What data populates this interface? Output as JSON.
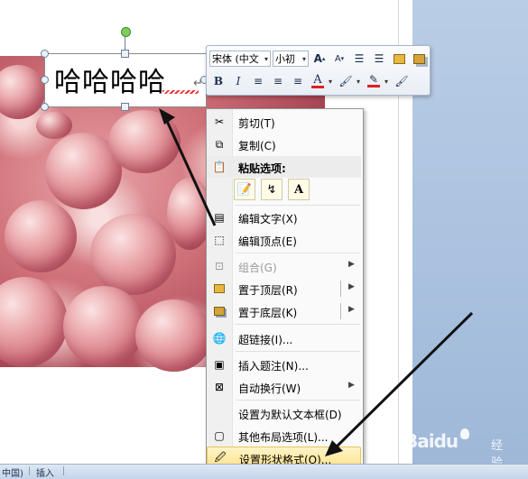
{
  "textbox": {
    "text": "哈哈哈哈"
  },
  "mini_toolbar": {
    "font_name": "宋体 (中文",
    "font_size": "小初",
    "row1_buttons": [
      "grow-font-icon",
      "shrink-font-icon",
      "decrease-indent-icon",
      "increase-indent-icon",
      "bring-forward-icon",
      "send-backward-icon"
    ],
    "row2_buttons": [
      "bold-icon",
      "italic-icon",
      "align-left-icon",
      "center-icon",
      "align-right-icon",
      "font-color-icon",
      "highlight-icon",
      "line-color-icon",
      "format-painter-icon"
    ],
    "bold_glyph": "B",
    "italic_glyph": "I",
    "font_color_glyph": "A"
  },
  "context_menu": {
    "cut": "剪切(T)",
    "copy": "复制(C)",
    "paste_options_title": "粘贴选项:",
    "paste_text_glyph": "A",
    "edit_text": "编辑文字(X)",
    "edit_points": "编辑顶点(E)",
    "group": "组合(G)",
    "bring_to_front": "置于顶层(R)",
    "send_to_back": "置于底层(K)",
    "hyperlink": "超链接(I)...",
    "insert_caption": "插入题注(N)...",
    "wrap_text": "自动换行(W)",
    "set_default_textbox": "设置为默认文本框(D)",
    "more_layout_options": "其他布局选项(L)...",
    "format_shape": "设置形状格式(O)..."
  },
  "status_bar": {
    "language": "中国)",
    "insert_mode": "插入"
  },
  "watermark": {
    "brand": "Baidu",
    "suffix": "经验"
  },
  "colors": {
    "highlight_bg": "#ffe28a",
    "menu_border": "#979797",
    "app_bg": "#c5d6ea",
    "font_color_red": "#e02020"
  }
}
